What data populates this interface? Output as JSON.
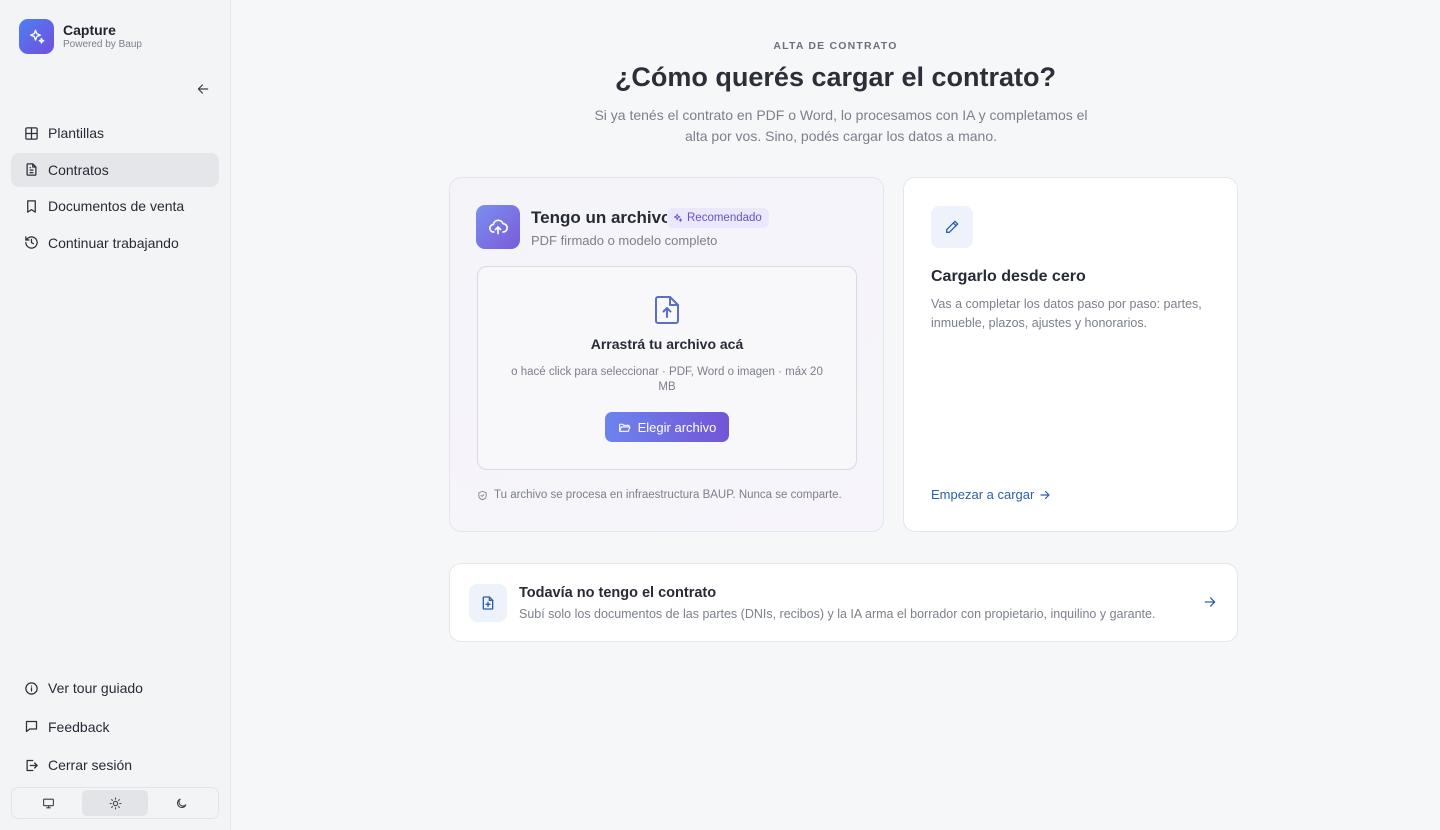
{
  "brand": {
    "name": "Capture",
    "subtitle": "Powered by Baup"
  },
  "sidebar": {
    "items": [
      {
        "label": "Plantillas",
        "icon": "grid-icon",
        "active": false
      },
      {
        "label": "Contratos",
        "icon": "document-icon",
        "active": true
      },
      {
        "label": "Documentos de venta",
        "icon": "bookmark-icon",
        "active": false
      },
      {
        "label": "Continuar trabajando",
        "icon": "history-icon",
        "active": false
      }
    ],
    "bottom_items": [
      {
        "label": "Ver tour guiado",
        "icon": "info-icon"
      },
      {
        "label": "Feedback",
        "icon": "message-icon"
      },
      {
        "label": "Cerrar sesión",
        "icon": "logout-icon"
      }
    ],
    "theme": {
      "options": [
        "monitor-icon",
        "sun-icon",
        "moon-icon"
      ],
      "selected": "sun-icon"
    }
  },
  "header": {
    "eyebrow": "ALTA DE CONTRATO",
    "title": "¿Cómo querés cargar el contrato?",
    "subtitle": "Si ya tenés el contrato en PDF o Word, lo procesamos con IA y completamos el alta por vos. Sino, podés cargar los datos a mano."
  },
  "upload_card": {
    "title": "Tengo un archivo",
    "badge": "Recomendado",
    "subtitle": "PDF firmado o modelo completo",
    "dropzone_title": "Arrastrá tu archivo acá",
    "dropzone_sub": "o hacé click para seleccionar · PDF, Word o imagen · máx 20 MB",
    "button": "Elegir archivo",
    "privacy": "Tu archivo se procesa en infraestructura BAUP. Nunca se comparte."
  },
  "manual_card": {
    "title": "Cargarlo desde cero",
    "description": "Vas a completar los datos paso por paso: partes, inmueble, plazos, ajustes y honorarios.",
    "link": "Empezar a cargar"
  },
  "no_contract_card": {
    "title": "Todavía no tengo el contrato",
    "description": "Subí solo los documentos de las partes (DNIs, recibos) y la IA arma el borrador con propietario, inquilino y garante."
  },
  "colors": {
    "accent": "#6f4fe0",
    "link": "#2d5fa8",
    "badge_bg": "#ece8fb"
  }
}
